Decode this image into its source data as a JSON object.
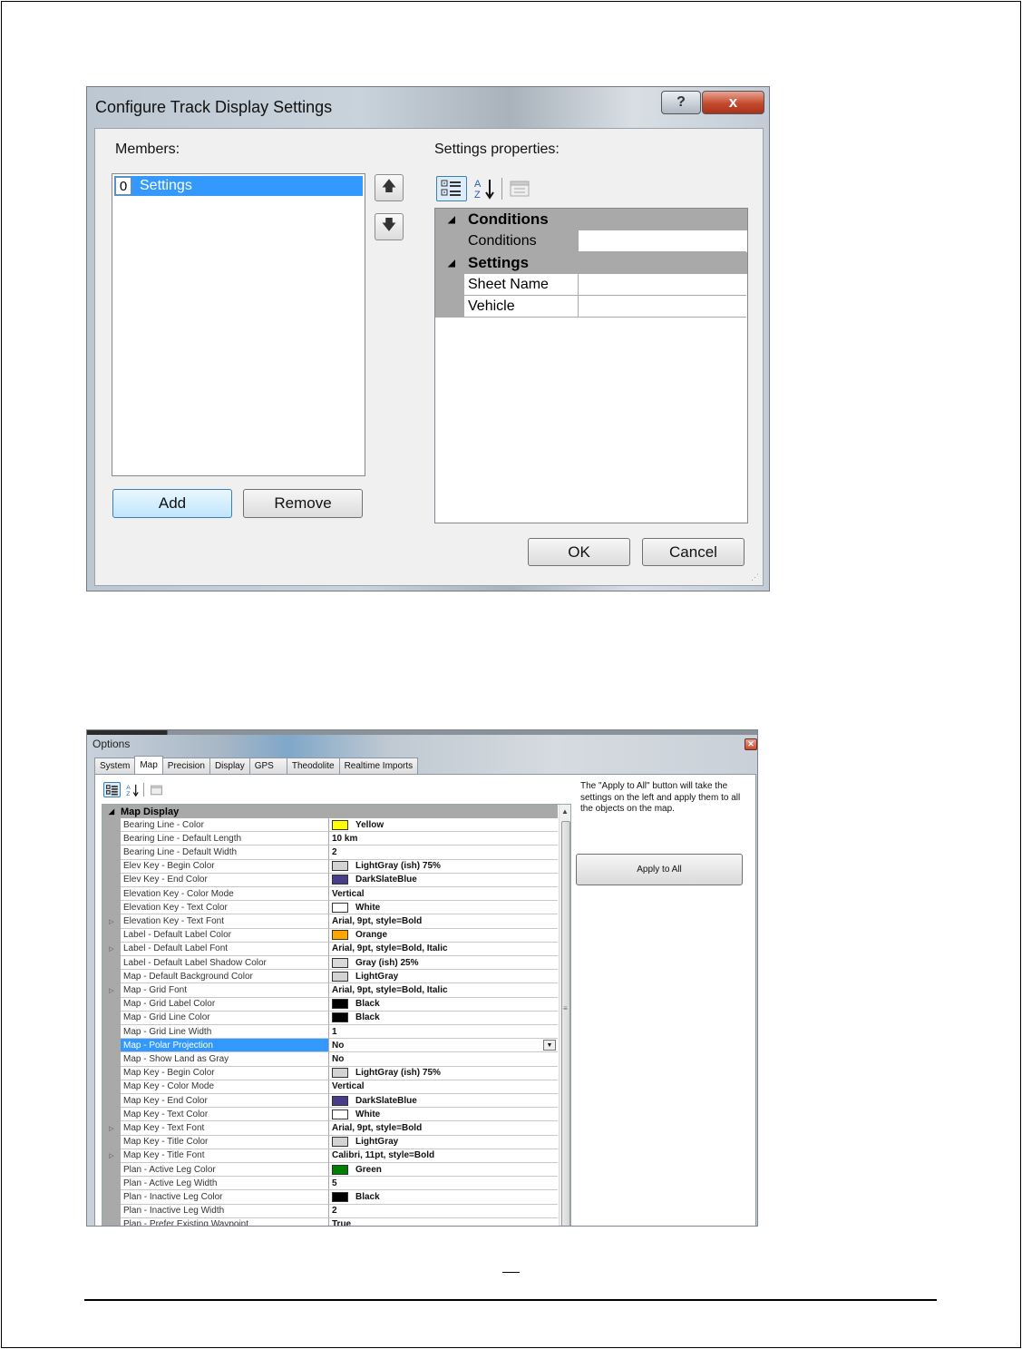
{
  "dialog1": {
    "title": "Configure Track Display Settings",
    "help_button": "?",
    "close_button": "x",
    "members_label": "Members:",
    "members": [
      {
        "index": "0",
        "name": "Settings"
      }
    ],
    "move_up": "🡅",
    "move_down": "🡇",
    "add_button": "Add",
    "remove_button": "Remove",
    "settings_label": "Settings properties:",
    "grid": [
      {
        "category": "Conditions",
        "properties": [
          {
            "name": "Conditions",
            "value": ""
          }
        ]
      },
      {
        "category": "Settings",
        "properties": [
          {
            "name": "Sheet Name",
            "value": ""
          },
          {
            "name": "Vehicle",
            "value": ""
          }
        ]
      }
    ],
    "ok_button": "OK",
    "cancel_button": "Cancel"
  },
  "dialog2": {
    "title": "Options",
    "tabs": [
      "System",
      "Map",
      "Precision",
      "Display",
      "GPS",
      "Theodolite",
      "Realtime Imports"
    ],
    "active_tab": "Map",
    "category": "Map Display",
    "rows": [
      {
        "name": "Bearing Line - Color",
        "value": "Yellow",
        "swatch": "#ffff00",
        "expand": false
      },
      {
        "name": "Bearing Line - Default Length",
        "value": "10 km",
        "swatch": null,
        "expand": false
      },
      {
        "name": "Bearing Line - Default Width",
        "value": "2",
        "swatch": null,
        "expand": false
      },
      {
        "name": "Elev Key - Begin Color",
        "value": "LightGray (ish) 75%",
        "swatch": "#d3d3d3",
        "expand": false
      },
      {
        "name": "Elev Key - End Color",
        "value": "DarkSlateBlue",
        "swatch": "#483d8b",
        "expand": false
      },
      {
        "name": "Elevation Key - Color Mode",
        "value": "Vertical",
        "swatch": null,
        "expand": false
      },
      {
        "name": "Elevation Key - Text Color",
        "value": "White",
        "swatch": "#ffffff",
        "expand": false
      },
      {
        "name": "Elevation Key - Text Font",
        "value": "Arial, 9pt, style=Bold",
        "swatch": null,
        "expand": true
      },
      {
        "name": "Label - Default Label Color",
        "value": "Orange",
        "swatch": "#ffa500",
        "expand": false
      },
      {
        "name": "Label - Default Label Font",
        "value": "Arial, 9pt, style=Bold, Italic",
        "swatch": null,
        "expand": true
      },
      {
        "name": "Label - Default Label Shadow Color",
        "value": "Gray (ish) 25%",
        "swatch": "#d9d9d9",
        "expand": false
      },
      {
        "name": "Map - Default Background Color",
        "value": "LightGray",
        "swatch": "#d3d3d3",
        "expand": false
      },
      {
        "name": "Map - Grid Font",
        "value": "Arial, 9pt, style=Bold, Italic",
        "swatch": null,
        "expand": true
      },
      {
        "name": "Map - Grid Label Color",
        "value": "Black",
        "swatch": "#000000",
        "expand": false
      },
      {
        "name": "Map - Grid Line Color",
        "value": "Black",
        "swatch": "#000000",
        "expand": false
      },
      {
        "name": "Map - Grid Line Width",
        "value": "1",
        "swatch": null,
        "expand": false
      },
      {
        "name": "Map - Polar Projection",
        "value": "No",
        "swatch": null,
        "expand": false,
        "selected": true
      },
      {
        "name": "Map - Show Land as Gray",
        "value": "No",
        "swatch": null,
        "expand": false
      },
      {
        "name": "Map Key - Begin Color",
        "value": "LightGray (ish) 75%",
        "swatch": "#d3d3d3",
        "expand": false
      },
      {
        "name": "Map Key - Color Mode",
        "value": "Vertical",
        "swatch": null,
        "expand": false
      },
      {
        "name": "Map Key - End Color",
        "value": "DarkSlateBlue",
        "swatch": "#483d8b",
        "expand": false
      },
      {
        "name": "Map Key - Text Color",
        "value": "White",
        "swatch": "#ffffff",
        "expand": false
      },
      {
        "name": "Map Key - Text Font",
        "value": "Arial, 9pt, style=Bold",
        "swatch": null,
        "expand": true
      },
      {
        "name": "Map Key - Title Color",
        "value": "LightGray",
        "swatch": "#d3d3d3",
        "expand": false
      },
      {
        "name": "Map Key - Title Font",
        "value": "Calibri, 11pt, style=Bold",
        "swatch": null,
        "expand": true
      },
      {
        "name": "Plan - Active Leg Color",
        "value": "Green",
        "swatch": "#008000",
        "expand": false
      },
      {
        "name": "Plan - Active Leg Width",
        "value": "5",
        "swatch": null,
        "expand": false
      },
      {
        "name": "Plan - Inactive Leg Color",
        "value": "Black",
        "swatch": "#000000",
        "expand": false
      },
      {
        "name": "Plan - Inactive Leg Width",
        "value": "2",
        "swatch": null,
        "expand": false
      },
      {
        "name": "Plan - Prefer Existing Waypoint",
        "value": "True",
        "swatch": null,
        "expand": false
      }
    ],
    "help_text": "The \"Apply to All\" button will take the settings on the left and apply them to all the objects on the map.",
    "apply_button": "Apply to All"
  }
}
